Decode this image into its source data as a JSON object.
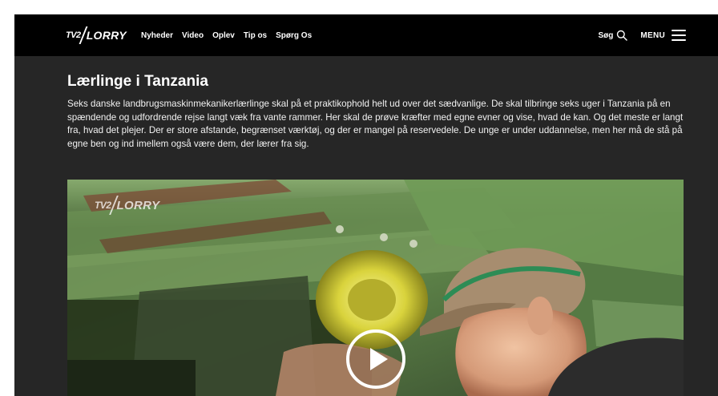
{
  "header": {
    "logo": {
      "brand": "TV2",
      "name": "LORRY"
    },
    "nav": [
      {
        "label": "Nyheder"
      },
      {
        "label": "Video"
      },
      {
        "label": "Oplev"
      },
      {
        "label": "Tip os"
      },
      {
        "label": "Spørg Os"
      }
    ],
    "search_label": "Søg",
    "search_icon": "search-icon",
    "menu_label": "MENU",
    "menu_icon": "hamburger-icon"
  },
  "article": {
    "title": "Lærlinge i Tanzania",
    "description": "Seks danske landbrugsmaskinmekanikerlærlinge skal på et praktikophold helt ud over det sædvanlige. De skal tilbringe seks uger i Tanzania på en spændende og udfordrende rejse langt væk fra vante rammer. Her skal de prøve kræfter med egne evner og vise, hvad de kan. Og det meste er langt fra, hvad det plejer. Der er store afstande, begrænset værktøj, og der er mangel på reservedele. De unge er under uddannelse, men her må de stå på egne ben og ind imellem også være dem, der lærer fra sig."
  },
  "video": {
    "watermark": {
      "brand": "TV2",
      "name": "LORRY"
    },
    "play_icon": "play-icon"
  },
  "colors": {
    "navbar_bg": "#000000",
    "page_bg": "#262626",
    "text": "#ffffff",
    "machine_green": "#5f8a4a"
  }
}
